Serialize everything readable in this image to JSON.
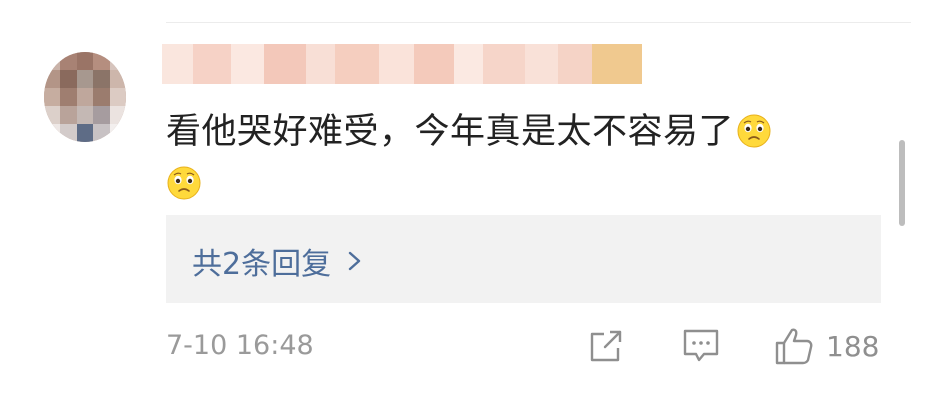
{
  "comment": {
    "text": "看他哭好难受，今年真是太不容易了",
    "emoji": [
      "pleading-face",
      "pleading-face"
    ],
    "replies_label": "共2条回复",
    "timestamp": "7-10 16:48",
    "like_count": "188"
  },
  "icons": {
    "share": "share-icon",
    "comment": "comment-icon",
    "like": "thumbs-up-icon",
    "chevron": "chevron-right-icon"
  },
  "colors": {
    "text": "#222222",
    "link": "#4e6e9b",
    "meta": "#9a9a9a",
    "reply_bg": "#f2f2f2",
    "icon": "#8f8f8f"
  }
}
